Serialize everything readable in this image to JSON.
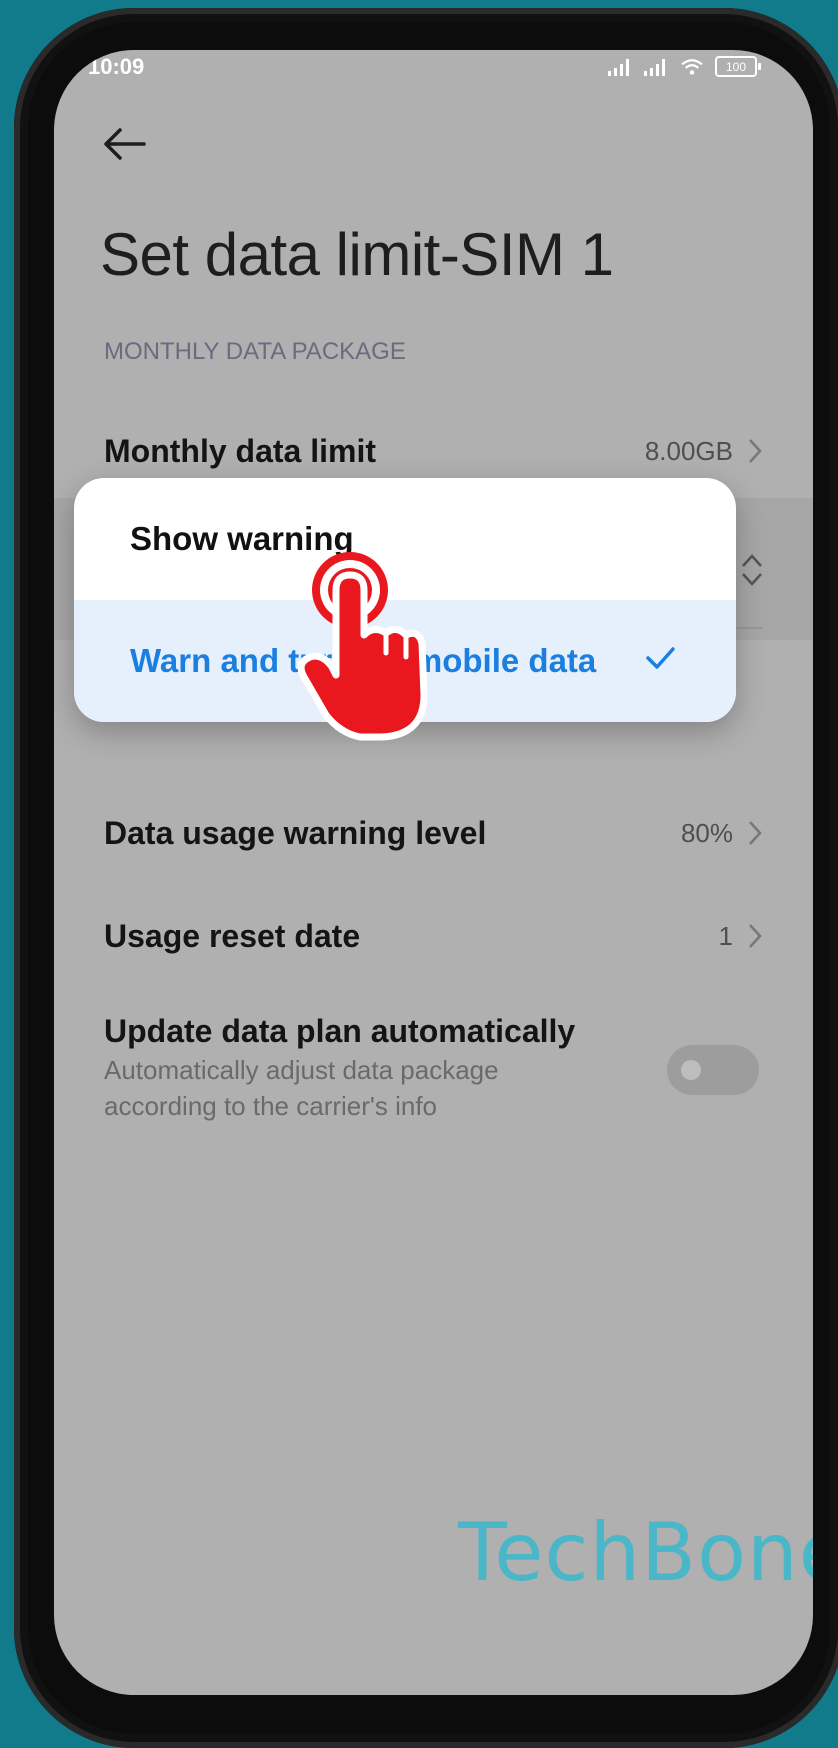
{
  "status_bar": {
    "time": "10:09",
    "battery": "100"
  },
  "page": {
    "title": "Set data limit-SIM 1",
    "section_label": "MONTHLY DATA PACKAGE"
  },
  "settings": {
    "monthly_limit": {
      "label": "Monthly data limit",
      "value": "8.00GB"
    },
    "warning_level": {
      "label": "Data usage warning level",
      "value": "80%"
    },
    "reset_date": {
      "label": "Usage reset date",
      "value": "1"
    },
    "update_plan": {
      "label": "Update data plan automatically",
      "sub_line1": "Automatically adjust data package",
      "sub_line2": "according to the carrier's info",
      "toggle_on": false
    }
  },
  "popup": {
    "options": [
      {
        "label": "Show warning",
        "selected": false
      },
      {
        "label": "Warn and turn off mobile data",
        "selected": true
      }
    ]
  },
  "watermark": "TechBone",
  "colors": {
    "accent": "#1a7fe0",
    "background": "#117a8b",
    "touch_indicator": "#e8181e"
  }
}
